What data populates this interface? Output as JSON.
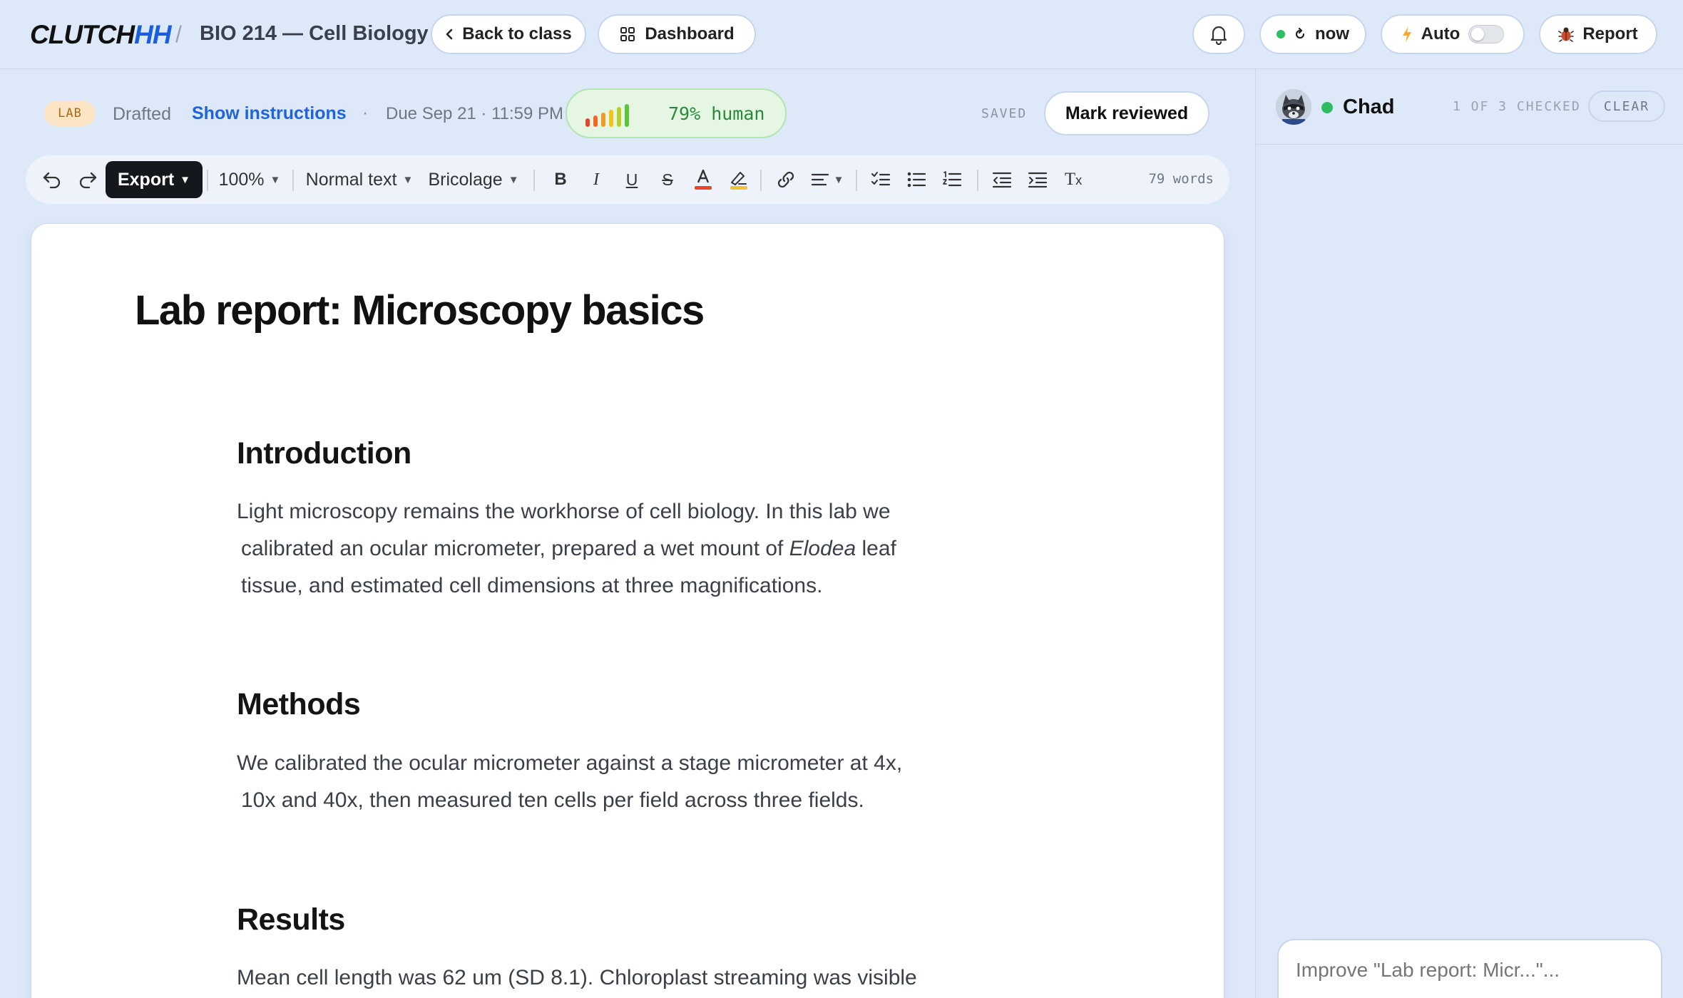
{
  "nav": {
    "brand_main": "CLUTCH",
    "brand_accent": "HH",
    "separator": "/",
    "course": "BIO 214 — Cell Biology",
    "back_label": "Back to class",
    "dashboard_label": "Dashboard",
    "now_label": "now",
    "auto_label": "Auto",
    "report_label": "Report"
  },
  "status": {
    "badge": "LAB",
    "state": "Drafted",
    "instructions_link": "Show instructions",
    "separator_dot": "·",
    "due": "Due Sep 21 · 11:59 PM",
    "human_score": "79% human",
    "human_fraction": 0.79,
    "saved": "SAVED",
    "mark_reviewed": "Mark reviewed"
  },
  "toolbar": {
    "export_label": "Export",
    "zoom": "100%",
    "style": "Normal text",
    "font": "Bricolage",
    "word_count": "79 words"
  },
  "document": {
    "title": "Lab report: Microscopy basics",
    "sections": [
      {
        "heading": "Introduction",
        "lines": [
          "Light microscopy remains the workhorse of cell biology. In this lab we",
          "calibrated an ocular micrometer, prepared a wet mount of ",
          "Elodea",
          " leaf",
          "tissue, and estimated cell dimensions at three magnifications."
        ]
      },
      {
        "heading": "Methods",
        "lines": [
          "We calibrated the ocular micrometer against a stage micrometer at 4x,",
          "10x and 40x, then measured ten cells per field across three fields."
        ]
      },
      {
        "heading": "Results",
        "lines": [
          "Mean cell length was 62 um (SD 8.1). Chloroplast streaming was visible"
        ]
      }
    ]
  },
  "sidebar": {
    "user": "Chad",
    "checked": "1 OF 3 CHECKED",
    "clear": "CLEAR",
    "input_placeholder": "Improve \"Lab report: Micr...\"..."
  },
  "colors": {
    "background": "#dde9f9",
    "accent": "#1e64dc",
    "human_green": "#2a8a3c",
    "online": "#2fbd63"
  }
}
